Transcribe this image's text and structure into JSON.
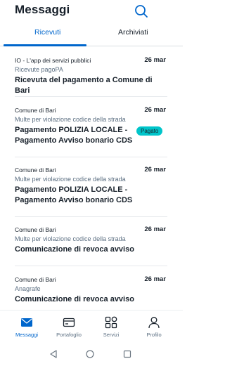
{
  "header": {
    "title": "Messaggi",
    "search_icon": "search-icon"
  },
  "tabs": [
    {
      "label": "Ricevuti",
      "active": true
    },
    {
      "label": "Archiviati",
      "active": false
    }
  ],
  "colors": {
    "accent": "#0066cc",
    "badge": "#00c5ca",
    "text": "#17202a",
    "secondary_text": "#5c6f82"
  },
  "messages": [
    {
      "sender": "IO - L'app dei servizi pubblici",
      "service": "Ricevute pagoPA",
      "subject": "Ricevuta del pagamento a Comune di Bari",
      "date": "26 mar",
      "badge": null
    },
    {
      "sender": "Comune di Bari",
      "service": "Multe per violazione codice della strada",
      "subject": "Pagamento POLIZIA LOCALE - Pagamento Avviso bonario CDS",
      "date": "26 mar",
      "badge": "Pagato"
    },
    {
      "sender": "Comune di Bari",
      "service": "Multe per violazione codice della strada",
      "subject": "Pagamento POLIZIA LOCALE - Pagamento Avviso bonario CDS",
      "date": "26 mar",
      "badge": null
    },
    {
      "sender": "Comune di Bari",
      "service": "Multe per violazione codice della strada",
      "subject": "Comunicazione di revoca avviso",
      "date": "26 mar",
      "badge": null
    },
    {
      "sender": "Comune di Bari",
      "service": "Anagrafe",
      "subject": "Comunicazione di revoca avviso",
      "date": "26 mar",
      "badge": null
    }
  ],
  "bottom_nav": [
    {
      "label": "Messaggi",
      "icon": "envelope-icon",
      "active": true
    },
    {
      "label": "Portafoglio",
      "icon": "wallet-icon",
      "active": false
    },
    {
      "label": "Servizi",
      "icon": "grid-icon",
      "active": false
    },
    {
      "label": "Profilo",
      "icon": "user-icon",
      "active": false
    }
  ],
  "system_nav": [
    {
      "icon": "back-triangle-icon"
    },
    {
      "icon": "home-circle-icon"
    },
    {
      "icon": "recents-square-icon"
    }
  ]
}
